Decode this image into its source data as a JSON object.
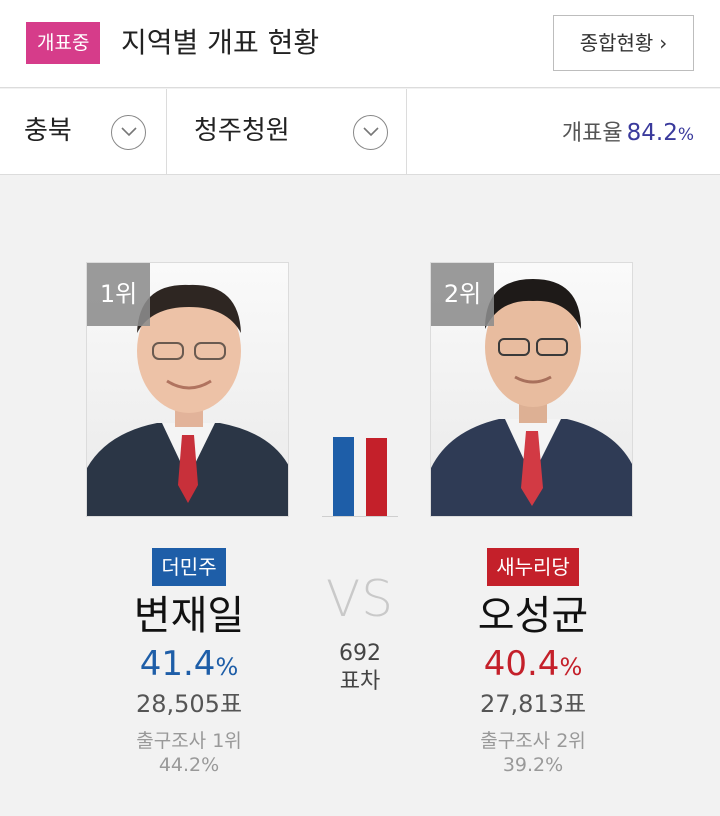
{
  "header": {
    "badge": "개표중",
    "title": "지역별 개표 현황",
    "summary_button": "종합현황",
    "summary_chevron": "›"
  },
  "filters": {
    "region": "충북",
    "district": "청주청원",
    "count_rate_label": "개표율",
    "count_rate_value": "84.2",
    "count_rate_unit": "%"
  },
  "candidates": [
    {
      "rank": "1위",
      "party": "더민주",
      "party_color": "#1e5ea8",
      "name": "변재일",
      "share_value": "41.4",
      "share_unit": "%",
      "share_fraction": 0.414,
      "votes": "28,505표",
      "exit_poll_label": "출구조사 1위",
      "exit_poll_value": "44.2%"
    },
    {
      "rank": "2위",
      "party": "새누리당",
      "party_color": "#c4202a",
      "name": "오성균",
      "share_value": "40.4",
      "share_unit": "%",
      "share_fraction": 0.404,
      "votes": "27,813표",
      "exit_poll_label": "출구조사 2위",
      "exit_poll_value": "39.2%"
    }
  ],
  "versus": {
    "vs_text": "VS",
    "gap_value": "692",
    "gap_label": "표차"
  }
}
